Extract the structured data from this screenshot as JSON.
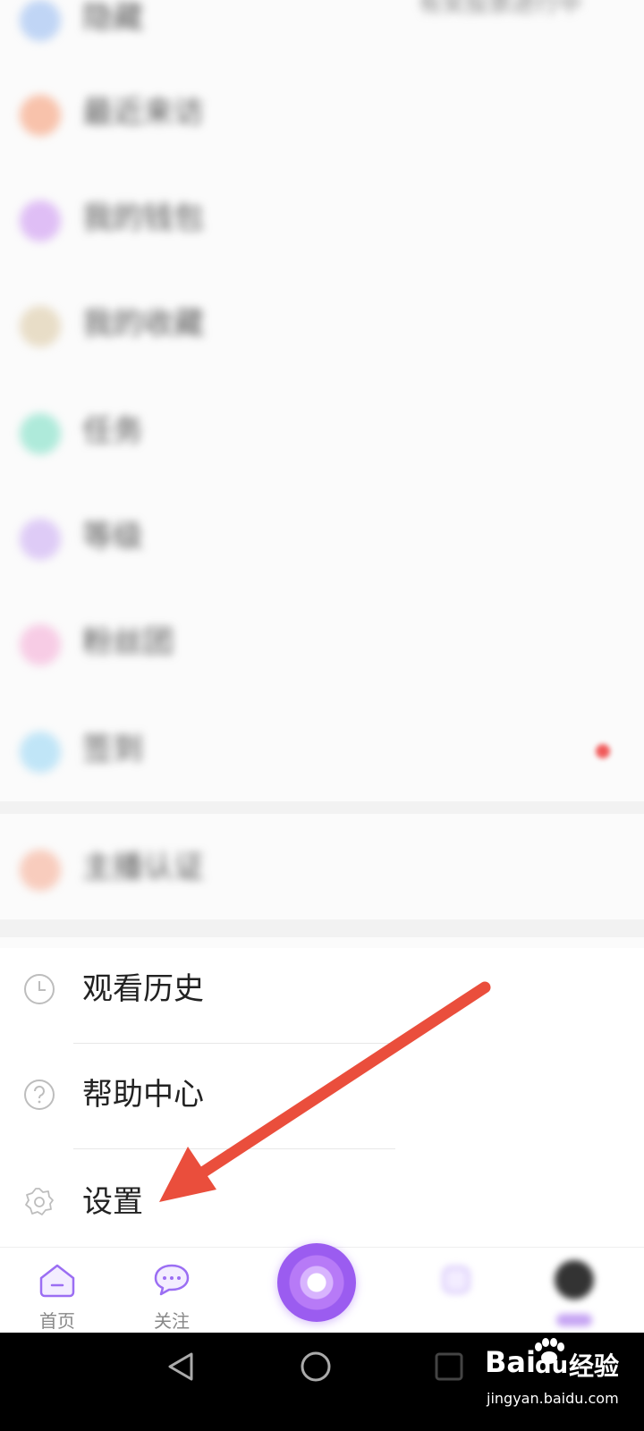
{
  "blurred_rows": [
    {
      "label": "最近来访",
      "icon_color": "#f6936a",
      "right_text": ""
    },
    {
      "label": "我的钱包",
      "icon_color": "#c88cf0",
      "right_text": ""
    },
    {
      "label": "我的收藏",
      "icon_color": "#d8c59c",
      "right_text": ""
    },
    {
      "label": "任务",
      "icon_color": "#6fdcc0",
      "right_text": ""
    },
    {
      "label": "等级",
      "icon_color": "#c6a4f3",
      "right_text": ""
    },
    {
      "label": "粉丝团",
      "icon_color": "#f4a6d4",
      "right_text": ""
    },
    {
      "label": "签到",
      "icon_color": "#8fd4f4",
      "right_text": ""
    },
    {
      "label": "主播认证",
      "icon_color": "#f5a58a",
      "right_text": ""
    }
  ],
  "top_partial": {
    "label": "隐藏",
    "right_text": "有奖投票进行中"
  },
  "menu": [
    {
      "label": "观看历史",
      "icon": "clock-icon"
    },
    {
      "label": "帮助中心",
      "icon": "help-icon"
    },
    {
      "label": "设置",
      "icon": "gear-icon"
    }
  ],
  "tabbar": {
    "home_label": "首页",
    "follow_label": "关注",
    "accent": "#9b6ef3"
  },
  "watermark": {
    "brand": "Bai",
    "brand2": "du",
    "suffix": "经验",
    "url": "jingyan.baidu.com"
  }
}
